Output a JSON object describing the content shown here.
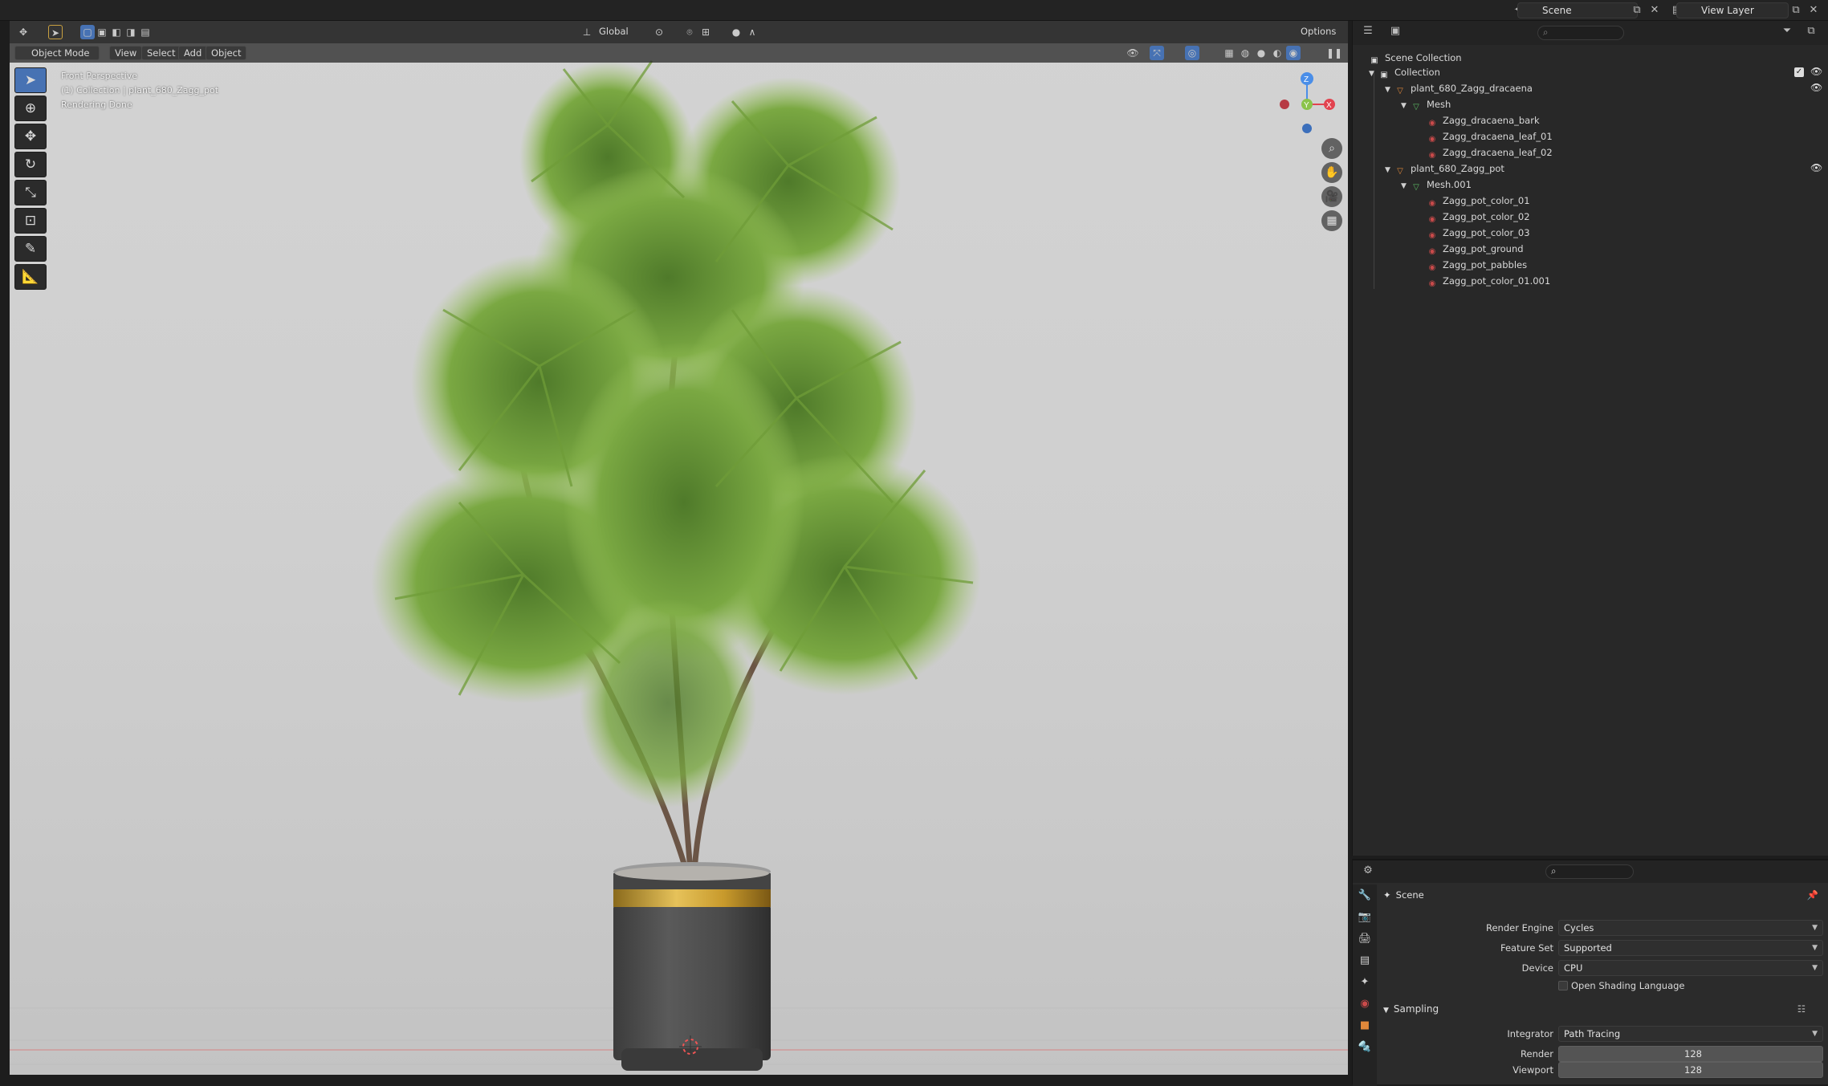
{
  "topbar": {
    "scene_label": "Scene",
    "view_layer_label": "View Layer"
  },
  "viewport": {
    "mode_label": "Object Mode",
    "menu": [
      "View",
      "Select",
      "Add",
      "Object"
    ],
    "transform_orientation": "Global",
    "options_label": "Options",
    "overlay_lines": [
      "Front Perspective",
      "(1) Collection | plant_680_Zagg_pot",
      "Rendering Done"
    ],
    "gizmo_axes": {
      "z": "Z",
      "y": "Y",
      "x": "X"
    }
  },
  "outliner": {
    "search_placeholder": "",
    "root": "Scene Collection",
    "items": [
      {
        "label": "Collection",
        "type": "collection",
        "level": 0,
        "expanded": true
      },
      {
        "label": "plant_680_Zagg_dracaena",
        "type": "object",
        "level": 1,
        "expanded": true
      },
      {
        "label": "Mesh",
        "type": "mesh",
        "level": 2,
        "expanded": true
      },
      {
        "label": "Zagg_dracaena_bark",
        "type": "material",
        "level": 3
      },
      {
        "label": "Zagg_dracaena_leaf_01",
        "type": "material",
        "level": 3
      },
      {
        "label": "Zagg_dracaena_leaf_02",
        "type": "material",
        "level": 3
      },
      {
        "label": "plant_680_Zagg_pot",
        "type": "object",
        "level": 1,
        "expanded": true
      },
      {
        "label": "Mesh.001",
        "type": "mesh",
        "level": 2,
        "expanded": true
      },
      {
        "label": "Zagg_pot_color_01",
        "type": "material",
        "level": 3
      },
      {
        "label": "Zagg_pot_color_02",
        "type": "material",
        "level": 3
      },
      {
        "label": "Zagg_pot_color_03",
        "type": "material",
        "level": 3
      },
      {
        "label": "Zagg_pot_ground",
        "type": "material",
        "level": 3
      },
      {
        "label": "Zagg_pot_pabbles",
        "type": "material",
        "level": 3
      },
      {
        "label": "Zagg_pot_color_01.001",
        "type": "material",
        "level": 3
      }
    ]
  },
  "properties": {
    "context_title": "Scene",
    "render_engine_label": "Render Engine",
    "render_engine_value": "Cycles",
    "feature_set_label": "Feature Set",
    "feature_set_value": "Supported",
    "device_label": "Device",
    "device_value": "CPU",
    "osl_label": "Open Shading Language",
    "sampling_label": "Sampling",
    "integrator_label": "Integrator",
    "integrator_value": "Path Tracing",
    "render_label": "Render",
    "render_value": "128",
    "viewport_label": "Viewport",
    "viewport_value": "128"
  },
  "colors": {
    "accent": "#4772b3",
    "material_icon": "#c94a4a",
    "object_icon": "#e0883a",
    "mesh_icon": "#5dbb63",
    "axis_x": "#e2434f",
    "axis_y": "#8bc34a",
    "axis_z": "#4a8ee8"
  }
}
